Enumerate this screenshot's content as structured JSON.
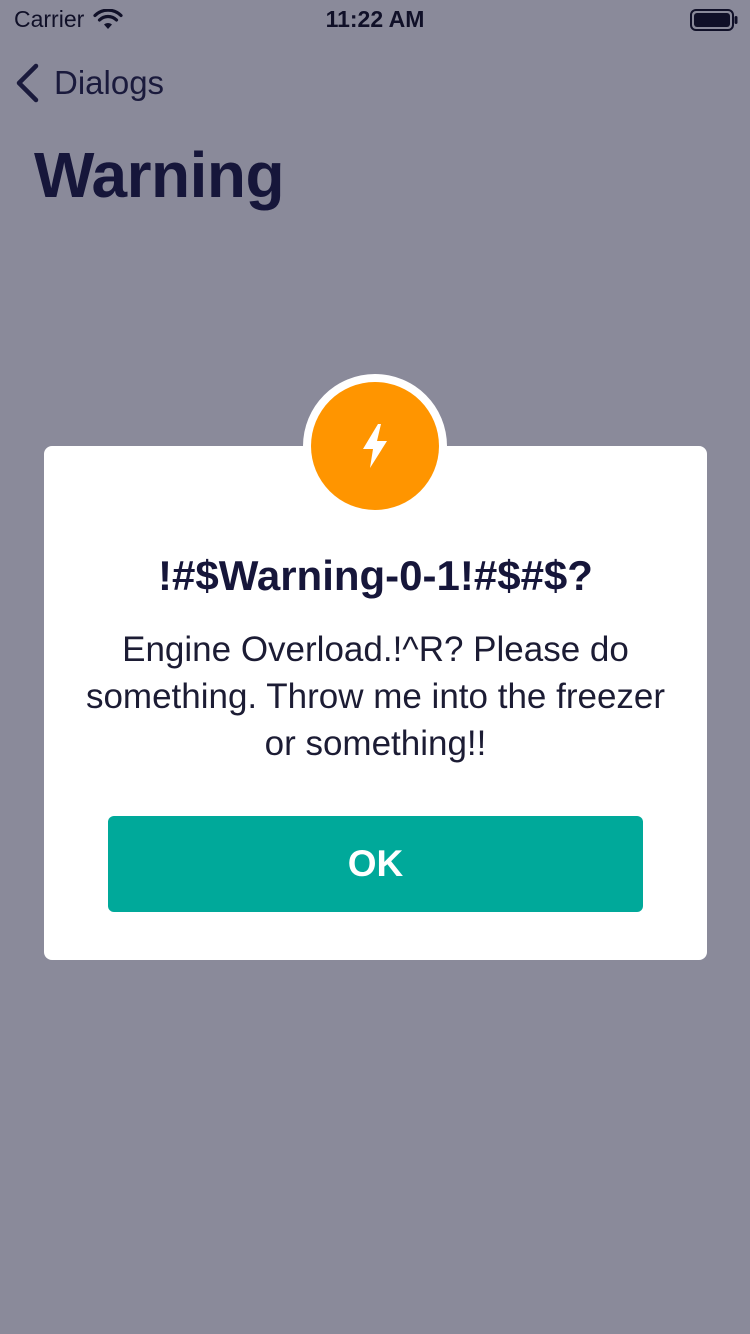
{
  "status_bar": {
    "carrier": "Carrier",
    "time": "11:22 AM",
    "wifi_icon": "wifi-icon",
    "battery_icon": "battery-icon"
  },
  "nav": {
    "back_label": "Dialogs",
    "back_icon": "chevron-left-icon"
  },
  "page": {
    "title": "Warning",
    "background_color": "#8a8a9a"
  },
  "dialog": {
    "icon": "lightning-bolt-icon",
    "icon_color": "#ff9500",
    "title": "!#$Warning-0-1!#$#$?",
    "message": "Engine Overload.!^R? Please do something. Throw me into the freezer or something!!",
    "button_label": "OK",
    "button_color": "#00a99a"
  }
}
